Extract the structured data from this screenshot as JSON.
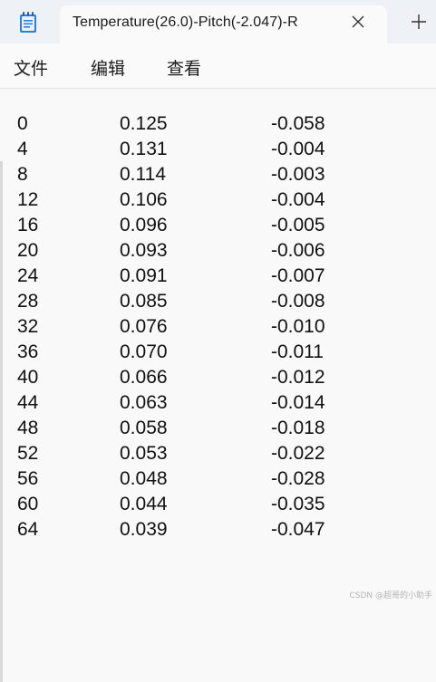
{
  "window": {
    "tab_title": "Temperature(26.0)-Pitch(-2.047)-R",
    "icons": {
      "app": "notepad-icon",
      "close": "close-icon",
      "new_tab": "plus-icon"
    }
  },
  "menu": {
    "file": "文件",
    "edit": "编辑",
    "view": "查看"
  },
  "table": {
    "rows": [
      [
        "0",
        "0.125",
        "-0.058"
      ],
      [
        "4",
        "0.131",
        "-0.004"
      ],
      [
        "8",
        "0.114",
        "-0.003"
      ],
      [
        "12",
        "0.106",
        "-0.004"
      ],
      [
        "16",
        "0.096",
        "-0.005"
      ],
      [
        "20",
        "0.093",
        "-0.006"
      ],
      [
        "24",
        "0.091",
        "-0.007"
      ],
      [
        "28",
        "0.085",
        "-0.008"
      ],
      [
        "32",
        "0.076",
        "-0.010"
      ],
      [
        "36",
        "0.070",
        "-0.011"
      ],
      [
        "40",
        "0.066",
        "-0.012"
      ],
      [
        "44",
        "0.063",
        "-0.014"
      ],
      [
        "48",
        "0.058",
        "-0.018"
      ],
      [
        "52",
        "0.053",
        "-0.022"
      ],
      [
        "56",
        "0.048",
        "-0.028"
      ],
      [
        "60",
        "0.044",
        "-0.035"
      ],
      [
        "64",
        "0.039",
        "-0.047"
      ]
    ]
  },
  "watermark": "CSDN @超哥的小助手"
}
